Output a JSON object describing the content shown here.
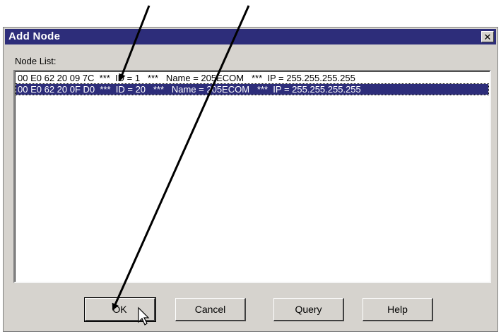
{
  "dialog": {
    "title": "Add  Node",
    "close_glyph": "✕",
    "list_label": "Node List:",
    "nodes": [
      "00 E0 62 20 09 7C  ***  ID = 1   ***   Name = 205ECOM   ***  IP = 255.255.255.255",
      "00 E0 62 20 0F D0  ***  ID = 20   ***   Name = 205ECOM   ***  IP = 255.255.255.255"
    ],
    "selected_index": 1,
    "buttons": {
      "ok": "OK",
      "cancel": "Cancel",
      "query": "Query",
      "help": "Help"
    }
  },
  "icons": [
    "close-icon",
    "mouse-cursor-icon",
    "annotation-arrow"
  ]
}
